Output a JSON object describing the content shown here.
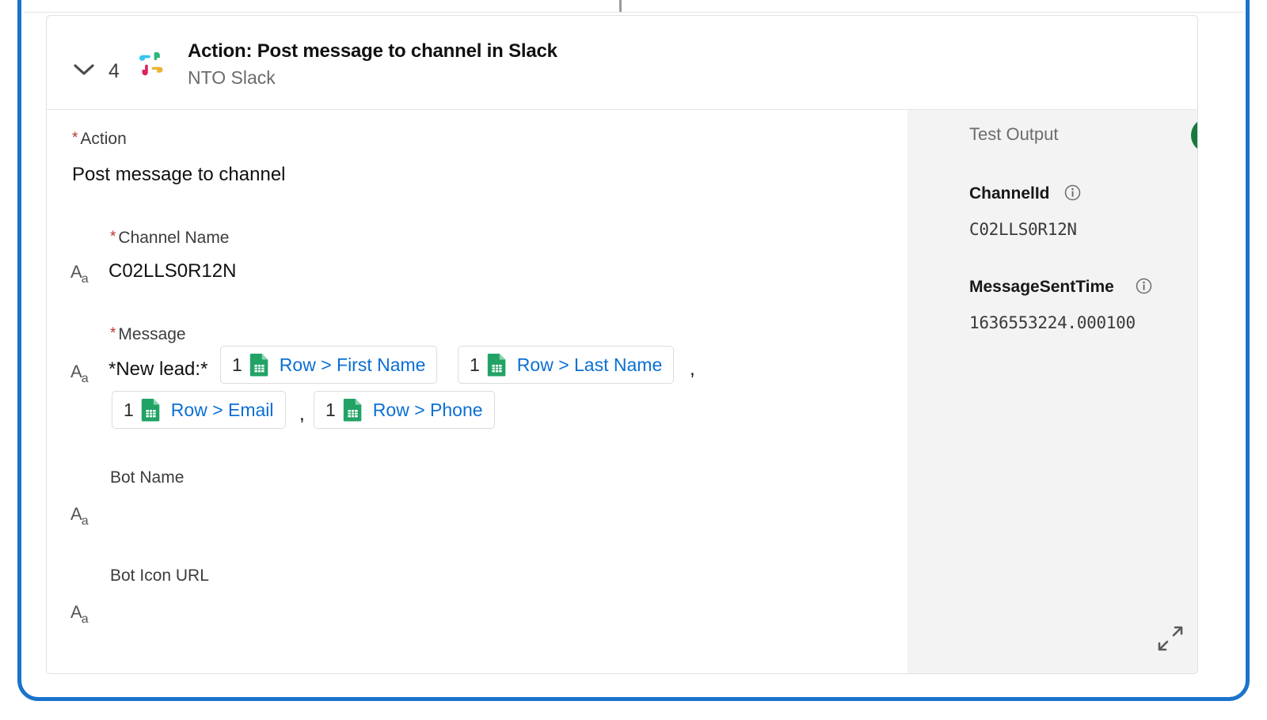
{
  "frame": {
    "accent_color": "#1a73cc"
  },
  "header": {
    "chevron_icon": "chevron-down-icon",
    "step_number": "4",
    "app_icon": "slack-icon",
    "title": "Action: Post message to channel in Slack",
    "subtitle": "NTO Slack"
  },
  "form": {
    "action": {
      "label": "Action",
      "required": true,
      "value": "Post message to channel"
    },
    "channel_name": {
      "label": "Channel Name",
      "required": true,
      "type_icon": "text-type-icon",
      "value": "C02LLS0R12N"
    },
    "message": {
      "label": "Message",
      "required": true,
      "type_icon": "text-type-icon",
      "prefix_text": "*New lead:*",
      "tokens": [
        {
          "index": "1",
          "source_icon": "google-sheets-icon",
          "reference": "Row > First Name",
          "trailing": ""
        },
        {
          "index": "1",
          "source_icon": "google-sheets-icon",
          "reference": "Row > Last Name",
          "trailing": ","
        },
        {
          "index": "1",
          "source_icon": "google-sheets-icon",
          "reference": "Row > Email",
          "trailing": ","
        },
        {
          "index": "1",
          "source_icon": "google-sheets-icon",
          "reference": "Row > Phone",
          "trailing": ""
        }
      ]
    },
    "bot_name": {
      "label": "Bot Name",
      "required": false,
      "type_icon": "text-type-icon",
      "value": ""
    },
    "bot_icon_url": {
      "label": "Bot Icon URL",
      "required": false,
      "type_icon": "text-type-icon",
      "value": ""
    }
  },
  "output": {
    "title": "Test Output",
    "status": "success",
    "status_color": "#167a3d",
    "entries": [
      {
        "key": "ChannelId",
        "info_icon": "info-icon",
        "value": "C02LLS0R12N"
      },
      {
        "key": "MessageSentTime",
        "info_icon": "info-icon",
        "value": "1636553224.000100"
      }
    ],
    "expand_icon": "expand-arrows-icon"
  }
}
